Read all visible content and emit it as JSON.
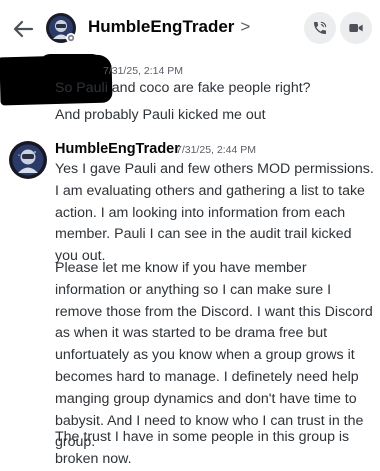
{
  "header": {
    "title": "HumbleEngTrader",
    "chevron": ">",
    "back_icon": "arrow-left-icon",
    "call_icon": "phone-icon",
    "video_icon": "video-camera-icon",
    "icon_bg": "#ebedef"
  },
  "messages": [
    {
      "author": "",
      "timestamp": "7/31/25, 2:14 PM",
      "lines": [
        "So Pauli and coco are fake people right?",
        "And probably Pauli kicked me out"
      ]
    },
    {
      "author": "HumbleEngTrader",
      "timestamp": "7/31/25, 2:44 PM",
      "paragraphs": [
        "Yes I gave Pauli and few others MOD permissions. I am evaluating others and gathering a list to take action. I am looking into information from each member. Pauli I can see in the audit trail kicked you out.",
        "Please let me know if you have member information or anything so I can make sure I remove those from the Discord. I want this Discord as when it was started to be drama free but unfortuately as you know when a group grows it becomes hard to manage. I definetely need help manging group dynamics and don't have time to babysit. And I need to know who I can trust in the group.",
        "The trust I have in some people in this group is broken now."
      ]
    }
  ]
}
